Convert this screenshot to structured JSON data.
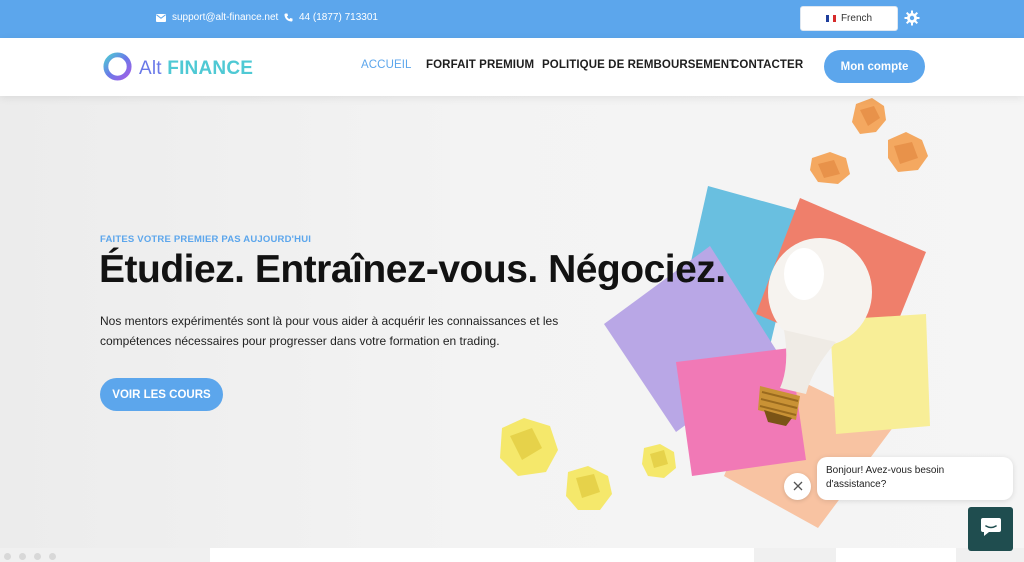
{
  "topbar": {
    "email": "support@alt-finance.net",
    "phone": "44 (1877) 713301",
    "language": "French"
  },
  "header": {
    "logo_alt": "Alt",
    "logo_finance": "FINANCE",
    "nav": [
      {
        "label": "ACCUEIL",
        "active": true
      },
      {
        "label": "FORFAIT PREMIUM",
        "active": false
      },
      {
        "label": "POLITIQUE DE REMBOURSEMENT",
        "active": false
      },
      {
        "label": "CONTACTER",
        "active": false
      }
    ],
    "account_button": "Mon compte"
  },
  "hero": {
    "eyebrow": "FAITES VOTRE PREMIER PAS AUJOURD'HUI",
    "headline": "Étudiez. Entraînez-vous. Négociez.",
    "description": "Nos mentors expérimentés sont là pour vous aider à acquérir les connaissances et les compétences nécessaires pour progresser dans votre formation en trading.",
    "cta": "VOIR LES COURS"
  },
  "chat": {
    "message": "Bonjour! Avez-vous besoin d'assistance?"
  },
  "colors": {
    "accent": "#5ca6ec",
    "chat_launcher": "#1f4d4f",
    "logo_purple": "#6a79e8",
    "logo_teal": "#4fc9d4"
  },
  "icons": [
    "envelope-icon",
    "phone-icon",
    "french-flag-icon",
    "gear-icon",
    "logo-ring-icon",
    "close-icon",
    "chat-icon"
  ]
}
